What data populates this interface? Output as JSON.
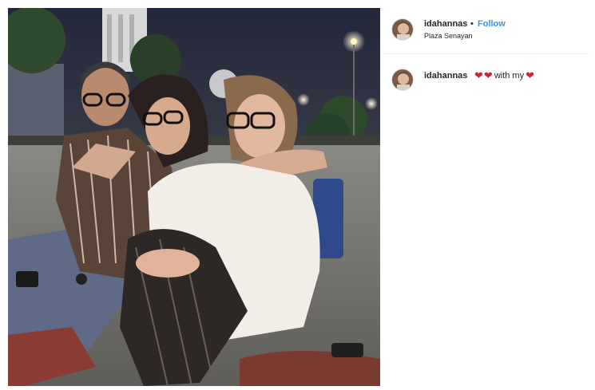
{
  "post": {
    "username": "idahannas",
    "separator": "•",
    "follow_label": "Follow",
    "location": "Plaza Senayan"
  },
  "caption": {
    "username": "idahannas",
    "text": "with my",
    "emoji": "heart-emoji",
    "heart_color": "#d0233a"
  },
  "colors": {
    "follow": "#3897f0",
    "text": "#262626",
    "divider": "#efefef"
  },
  "icons": {
    "avatar": "profile-photo",
    "heart": "red-heart-emoji"
  }
}
